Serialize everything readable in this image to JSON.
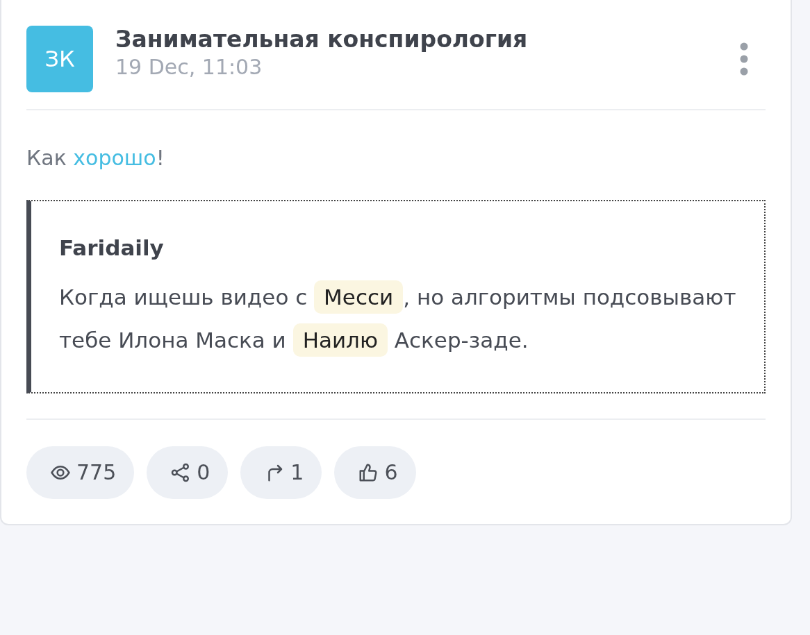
{
  "post": {
    "avatar": "ЗК",
    "title": "Занимательная конспирология",
    "time": "19 Dec, 11:03",
    "text": [
      {
        "kind": "plain",
        "text": "Как "
      },
      {
        "kind": "link",
        "text": "хорошо"
      },
      {
        "kind": "plain",
        "text": "!"
      }
    ],
    "quote": {
      "author": "Faridaily",
      "text": [
        {
          "kind": "plain",
          "text": "Когда ищешь видео с "
        },
        {
          "kind": "mention",
          "text": "Месси"
        },
        {
          "kind": "plain",
          "text": ", но алгоритмы подсовывают тебе Илона Маска и "
        },
        {
          "kind": "mention",
          "text": "Наилю"
        },
        {
          "kind": "plain",
          "text": " Аскер-заде."
        }
      ]
    },
    "stats": [
      {
        "kind": "views",
        "value": "775"
      },
      {
        "kind": "shares",
        "value": "0"
      },
      {
        "kind": "forwards",
        "value": "1"
      },
      {
        "kind": "likes",
        "value": "6"
      }
    ]
  }
}
